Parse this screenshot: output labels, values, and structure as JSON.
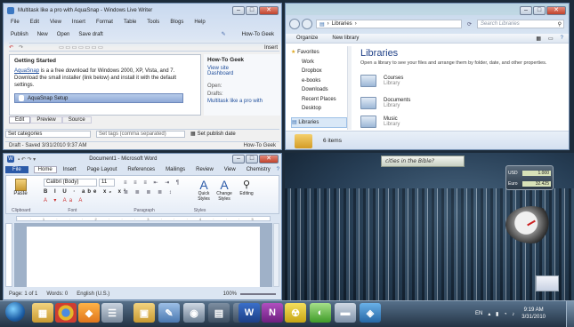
{
  "writer": {
    "title": "Multitask like a pro with AquaSnap - Windows Live Writer",
    "menu": [
      "File",
      "Edit",
      "View",
      "Insert",
      "Format",
      "Table",
      "Tools",
      "Blogs",
      "Help"
    ],
    "toolbar": [
      "Publish",
      "New",
      "Open",
      "Save draft"
    ],
    "blog_name": "How-To Geek",
    "insert_label": "Insert",
    "post_heading": "Getting Started",
    "post_link": "AquaSnap",
    "post_body": " is a a free download for Windows 2000, XP, Vista, and 7.  Download the small installer (link below) and install it with the default settings.",
    "file_box": "AquaSnap Setup",
    "side_title": "How-To Geek",
    "side_links": [
      "View site",
      "Dashboard"
    ],
    "side_open": "Open:",
    "side_drafts": "Drafts:",
    "side_draft_item": "Multitask like a pro with",
    "view_tabs": [
      "Edit",
      "Preview",
      "Source"
    ],
    "set_categories": "Set categories",
    "set_tags": "Set tags (comma separated)",
    "set_publish": "Set publish date",
    "status": "Draft - Saved 3/31/2010 9:37 AM",
    "status_right": "How-To Geek"
  },
  "explorer": {
    "address": "Libraries",
    "search_placeholder": "Search Libraries",
    "toolbar": [
      "Organize",
      "New library"
    ],
    "nav": [
      "Favorites",
      "Work",
      "Dropbox",
      "e-books",
      "Downloads",
      "Recent Places",
      "Desktop",
      "Libraries"
    ],
    "heading": "Libraries",
    "subtitle": "Open a library to see your files and arrange them by folder, date, and other properties.",
    "items": [
      {
        "name": "Courses",
        "type": "Library"
      },
      {
        "name": "Documents",
        "type": "Library"
      },
      {
        "name": "Music",
        "type": "Library"
      }
    ],
    "status": "6 items"
  },
  "word": {
    "title": "Document1 - Microsoft Word",
    "tabs": [
      "File",
      "Home",
      "Insert",
      "Page Layout",
      "References",
      "Mailings",
      "Review",
      "View",
      "Chemistry"
    ],
    "font": "Calibri (Body)",
    "size": "11",
    "paste": "Paste",
    "styles": [
      "Quick Styles",
      "Change Styles",
      "Editing"
    ],
    "groups": [
      "Clipboard",
      "Font",
      "Paragraph",
      "Styles"
    ],
    "status": [
      "Page: 1 of 1",
      "Words: 0",
      "English (U.S.)"
    ],
    "zoom": "100%"
  },
  "desktop": {
    "banner": "cities in the Bible?",
    "currency": [
      {
        "label": "USD",
        "value": "1.000"
      },
      {
        "label": "Euro",
        "value": "32.425"
      }
    ]
  },
  "taskbar": {
    "lang": "EN",
    "time": "9:19 AM",
    "date": "3/31/2010"
  }
}
